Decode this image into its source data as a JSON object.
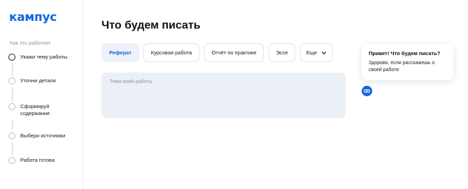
{
  "app": {
    "logo": "кампус"
  },
  "sidebar": {
    "section_label": "Как это работает",
    "steps": [
      {
        "label": "Укажи тему работы",
        "active": true
      },
      {
        "label": "Уточни детали",
        "active": false
      },
      {
        "label": "Сформируй содержание",
        "active": false
      },
      {
        "label": "Выбери источники",
        "active": false
      },
      {
        "label": "Работа готова",
        "active": false
      }
    ]
  },
  "main": {
    "title": "Что будем писать",
    "tabs": [
      {
        "label": "Реферат",
        "selected": true
      },
      {
        "label": "Курсовая работа",
        "selected": false
      },
      {
        "label": "Отчёт по практике",
        "selected": false
      },
      {
        "label": "Эссе",
        "selected": false
      },
      {
        "label": "Еще",
        "selected": false,
        "icon": "chevron-down-icon"
      }
    ],
    "topic_input": {
      "placeholder": "Тема моей работы",
      "value": ""
    }
  },
  "assistant": {
    "bubble_title": "Привет! Что будем писать?",
    "bubble_text": "Здорово, если расскажешь о своей работе",
    "avatar_icon": "bot-avatar-icon"
  },
  "colors": {
    "accent": "#1565e0",
    "input_bg": "#ebeff6",
    "muted_text": "#8a94a6"
  }
}
